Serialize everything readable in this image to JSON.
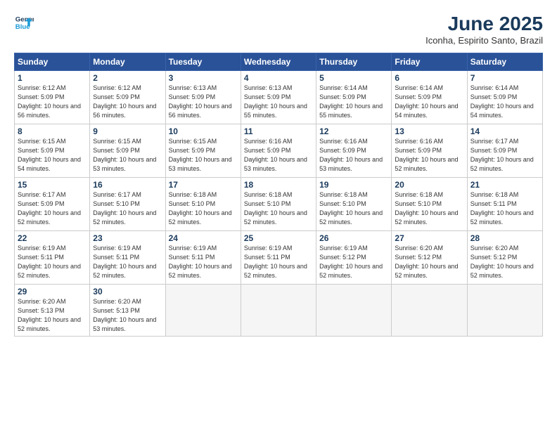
{
  "logo": {
    "line1": "General",
    "line2": "Blue"
  },
  "title": "June 2025",
  "subtitle": "Iconha, Espirito Santo, Brazil",
  "days_header": [
    "Sunday",
    "Monday",
    "Tuesday",
    "Wednesday",
    "Thursday",
    "Friday",
    "Saturday"
  ],
  "weeks": [
    [
      {
        "num": "1",
        "rise": "6:12 AM",
        "set": "5:09 PM",
        "daylight": "10 hours and 56 minutes."
      },
      {
        "num": "2",
        "rise": "6:12 AM",
        "set": "5:09 PM",
        "daylight": "10 hours and 56 minutes."
      },
      {
        "num": "3",
        "rise": "6:13 AM",
        "set": "5:09 PM",
        "daylight": "10 hours and 56 minutes."
      },
      {
        "num": "4",
        "rise": "6:13 AM",
        "set": "5:09 PM",
        "daylight": "10 hours and 55 minutes."
      },
      {
        "num": "5",
        "rise": "6:14 AM",
        "set": "5:09 PM",
        "daylight": "10 hours and 55 minutes."
      },
      {
        "num": "6",
        "rise": "6:14 AM",
        "set": "5:09 PM",
        "daylight": "10 hours and 54 minutes."
      },
      {
        "num": "7",
        "rise": "6:14 AM",
        "set": "5:09 PM",
        "daylight": "10 hours and 54 minutes."
      }
    ],
    [
      {
        "num": "8",
        "rise": "6:15 AM",
        "set": "5:09 PM",
        "daylight": "10 hours and 54 minutes."
      },
      {
        "num": "9",
        "rise": "6:15 AM",
        "set": "5:09 PM",
        "daylight": "10 hours and 53 minutes."
      },
      {
        "num": "10",
        "rise": "6:15 AM",
        "set": "5:09 PM",
        "daylight": "10 hours and 53 minutes."
      },
      {
        "num": "11",
        "rise": "6:16 AM",
        "set": "5:09 PM",
        "daylight": "10 hours and 53 minutes."
      },
      {
        "num": "12",
        "rise": "6:16 AM",
        "set": "5:09 PM",
        "daylight": "10 hours and 53 minutes."
      },
      {
        "num": "13",
        "rise": "6:16 AM",
        "set": "5:09 PM",
        "daylight": "10 hours and 52 minutes."
      },
      {
        "num": "14",
        "rise": "6:17 AM",
        "set": "5:09 PM",
        "daylight": "10 hours and 52 minutes."
      }
    ],
    [
      {
        "num": "15",
        "rise": "6:17 AM",
        "set": "5:09 PM",
        "daylight": "10 hours and 52 minutes."
      },
      {
        "num": "16",
        "rise": "6:17 AM",
        "set": "5:10 PM",
        "daylight": "10 hours and 52 minutes."
      },
      {
        "num": "17",
        "rise": "6:18 AM",
        "set": "5:10 PM",
        "daylight": "10 hours and 52 minutes."
      },
      {
        "num": "18",
        "rise": "6:18 AM",
        "set": "5:10 PM",
        "daylight": "10 hours and 52 minutes."
      },
      {
        "num": "19",
        "rise": "6:18 AM",
        "set": "5:10 PM",
        "daylight": "10 hours and 52 minutes."
      },
      {
        "num": "20",
        "rise": "6:18 AM",
        "set": "5:10 PM",
        "daylight": "10 hours and 52 minutes."
      },
      {
        "num": "21",
        "rise": "6:18 AM",
        "set": "5:11 PM",
        "daylight": "10 hours and 52 minutes."
      }
    ],
    [
      {
        "num": "22",
        "rise": "6:19 AM",
        "set": "5:11 PM",
        "daylight": "10 hours and 52 minutes."
      },
      {
        "num": "23",
        "rise": "6:19 AM",
        "set": "5:11 PM",
        "daylight": "10 hours and 52 minutes."
      },
      {
        "num": "24",
        "rise": "6:19 AM",
        "set": "5:11 PM",
        "daylight": "10 hours and 52 minutes."
      },
      {
        "num": "25",
        "rise": "6:19 AM",
        "set": "5:11 PM",
        "daylight": "10 hours and 52 minutes."
      },
      {
        "num": "26",
        "rise": "6:19 AM",
        "set": "5:12 PM",
        "daylight": "10 hours and 52 minutes."
      },
      {
        "num": "27",
        "rise": "6:20 AM",
        "set": "5:12 PM",
        "daylight": "10 hours and 52 minutes."
      },
      {
        "num": "28",
        "rise": "6:20 AM",
        "set": "5:12 PM",
        "daylight": "10 hours and 52 minutes."
      }
    ],
    [
      {
        "num": "29",
        "rise": "6:20 AM",
        "set": "5:13 PM",
        "daylight": "10 hours and 52 minutes."
      },
      {
        "num": "30",
        "rise": "6:20 AM",
        "set": "5:13 PM",
        "daylight": "10 hours and 53 minutes."
      },
      null,
      null,
      null,
      null,
      null
    ]
  ]
}
